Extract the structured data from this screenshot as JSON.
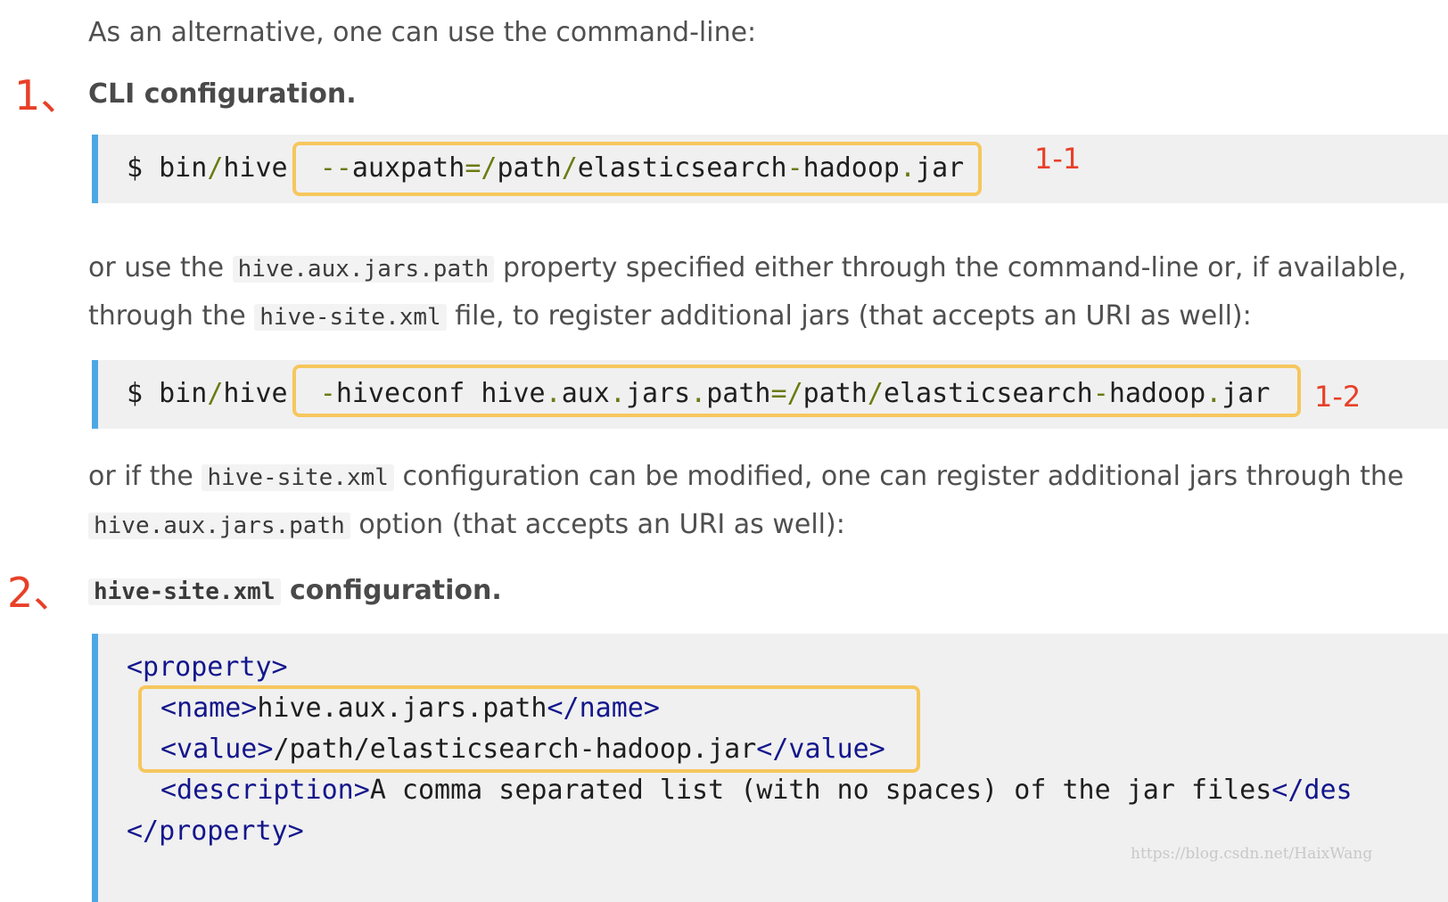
{
  "intro": "As an alternative, one can use the command-line:",
  "section1": {
    "marker": "1、",
    "heading": "CLI configuration."
  },
  "code1": {
    "prompt": "$ bin",
    "slash": "/",
    "cmd": "hive",
    "opt": "--auxpath",
    "eq": "=",
    "p1": "path",
    "jar_a": "elasticsearch",
    "dash": "-",
    "jar_b": "hadoop",
    "dot": ".",
    "ext": "jar",
    "label": "1-1"
  },
  "para2": {
    "t1": "or use the",
    "c1": "hive.aux.jars.path",
    "t2": "property specified either through the command-line or, if available,",
    "t3": "through the",
    "c2": "hive-site.xml",
    "t4": "file, to register additional jars (that accepts an URI as well):"
  },
  "code2": {
    "opt": "-hiveconf",
    "k1": "hive",
    "k2": "aux",
    "k3": "jars",
    "k4": "path",
    "label": "1-2"
  },
  "para3": {
    "t1": "or if the",
    "c1": "hive-site.xml",
    "t2": "configuration can be modified, one can register additional jars through the",
    "c2": "hive.aux.jars.path",
    "t3": "option (that accepts an URI as well):"
  },
  "section2": {
    "marker": "2、",
    "code": "hive-site.xml",
    "heading": "configuration."
  },
  "code3": {
    "open_property": "<property>",
    "name_open": "<name>",
    "name_value": "hive.aux.jars.path",
    "name_close": "</name>",
    "value_open": "<value>",
    "value_value": "/path/elasticsearch-hadoop.jar",
    "value_close": "</value>",
    "desc_open": "<description>",
    "desc_value": "A comma separated list (with no spaces) of the jar files",
    "desc_close": "</des",
    "close_property": "</property>"
  },
  "watermark": "https://blog.csdn.net/HaixWang",
  "colors": {
    "accent_bar": "#4ea7e5",
    "highlight_box": "#f6c75d",
    "annotation": "#e84028",
    "xml_tag": "#14178c"
  }
}
